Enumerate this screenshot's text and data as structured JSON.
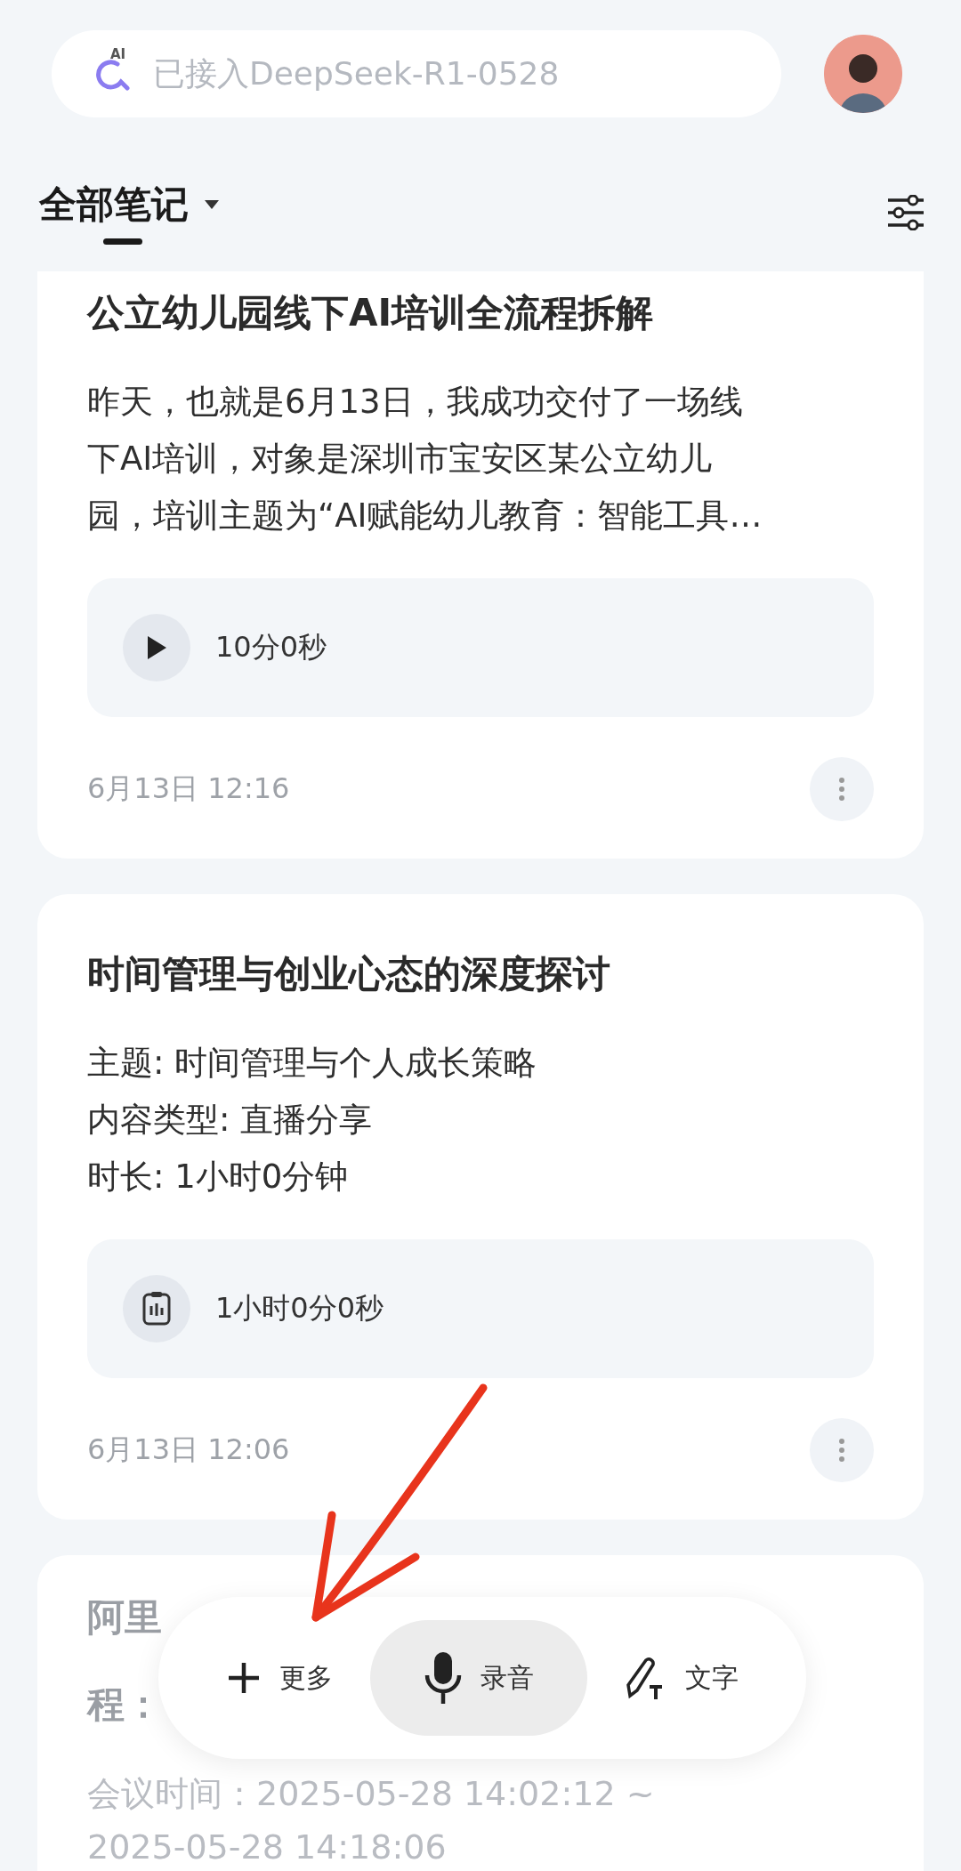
{
  "search": {
    "icon_text": "AI",
    "placeholder": "已接入DeepSeek-R1-0528"
  },
  "header": {
    "title": "全部笔记"
  },
  "notes": [
    {
      "title": "公立幼儿园线下AI培训全流程拆解",
      "lines": [
        "昨天，也就是6月13日，我成功交付了一场线",
        "下AI培训，对象是深圳市宝安区某公立幼儿",
        "园，培训主题为“AI赋能幼儿教育：智能工具…"
      ],
      "media": {
        "kind": "play",
        "duration": "10分0秒"
      },
      "date": "6月13日 12:16"
    },
    {
      "title": "时间管理与创业心态的深度探讨",
      "lines": [
        "主题: 时间管理与个人成长策略",
        "内容类型: 直播分享",
        "时长: 1小时0分钟"
      ],
      "media": {
        "kind": "recording",
        "duration": "1小时0分0秒"
      },
      "date": "6月13日 12:06"
    },
    {
      "title_lines": [
        "阿里",
        "程："
      ],
      "lines": [
        "会议时间：2025-05-28 14:02:12 ~",
        "2025-05-28 14:18:06"
      ]
    }
  ],
  "actions": [
    {
      "kind": "more",
      "label": "更多",
      "selected": false
    },
    {
      "kind": "record",
      "label": "录音",
      "selected": true
    },
    {
      "kind": "text",
      "label": "文字",
      "selected": false
    }
  ]
}
